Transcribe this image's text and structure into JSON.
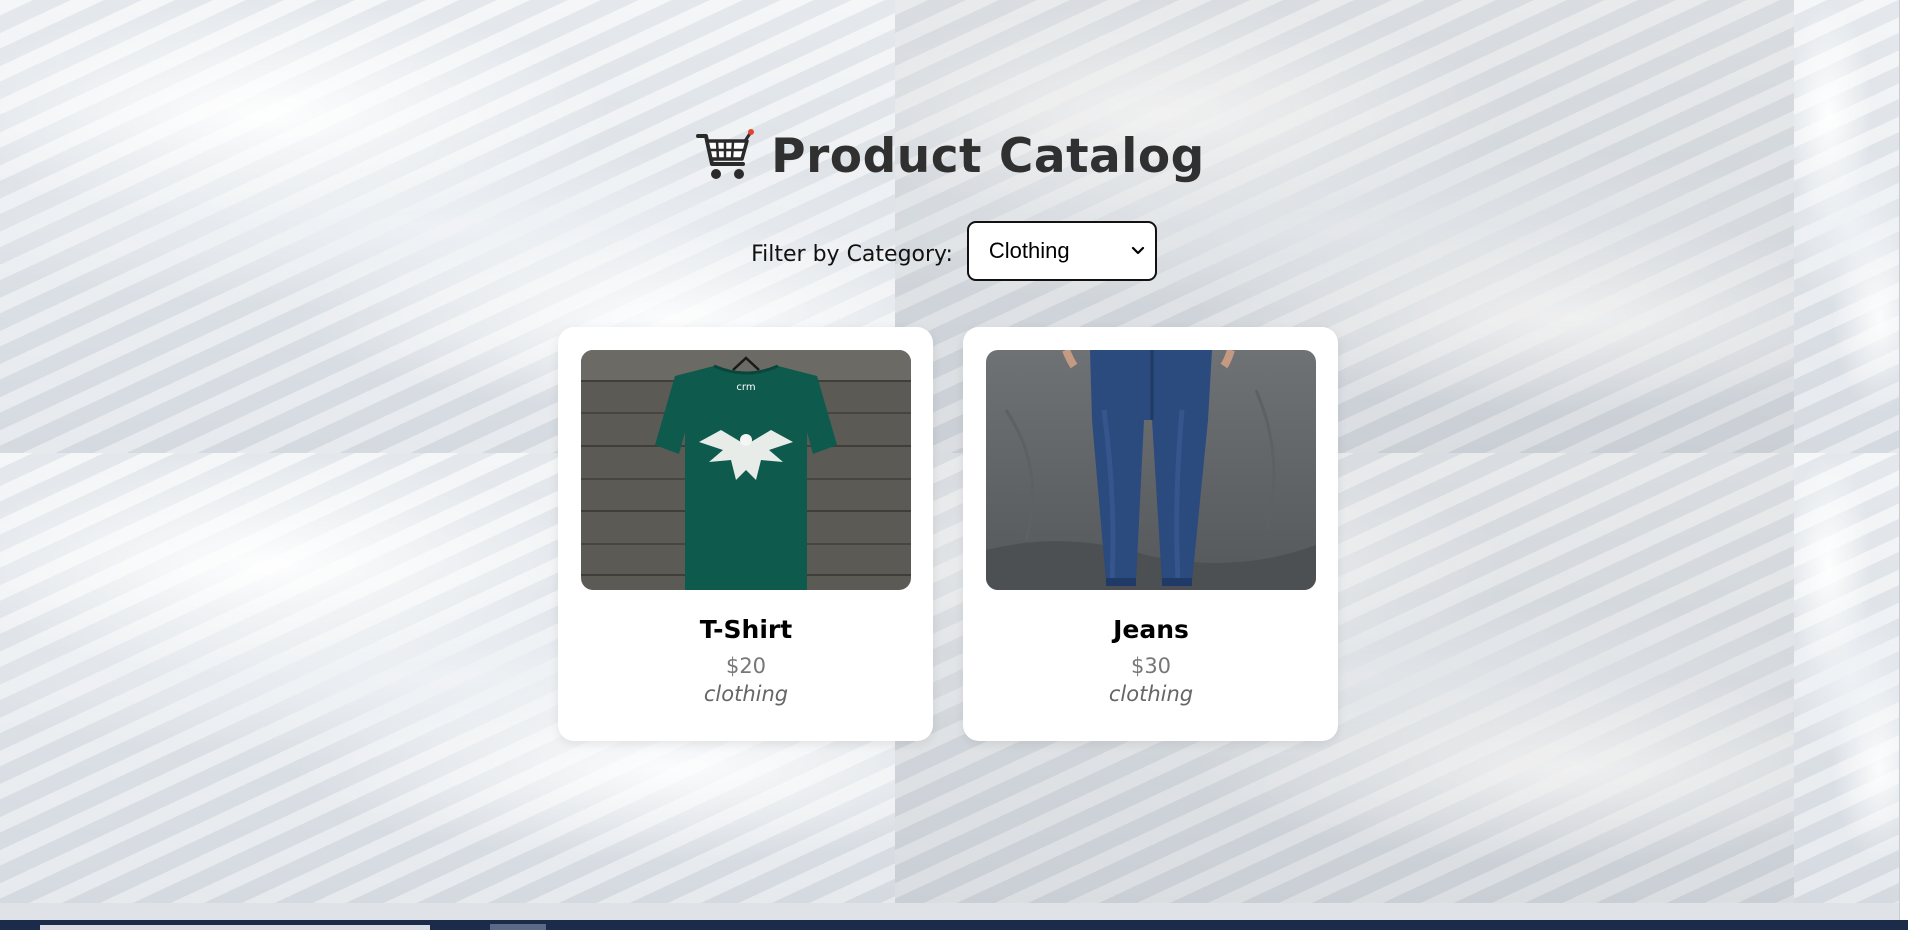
{
  "page": {
    "title": "Product Catalog",
    "title_icon": "shopping-cart-icon"
  },
  "filter": {
    "label": "Filter by Category:",
    "selected": "Clothing"
  },
  "products": [
    {
      "name": "T-Shirt",
      "price": "$20",
      "category": "clothing",
      "image": "green-tshirt-eagle-print",
      "image_logo_text": "crm"
    },
    {
      "name": "Jeans",
      "price": "$30",
      "category": "clothing",
      "image": "blue-jeans-model"
    }
  ],
  "colors": {
    "title": "#303030",
    "card_background": "#ffffff",
    "price": "#777777",
    "tshirt": "#0e5a4d",
    "jeans": "#2b4a7e"
  }
}
